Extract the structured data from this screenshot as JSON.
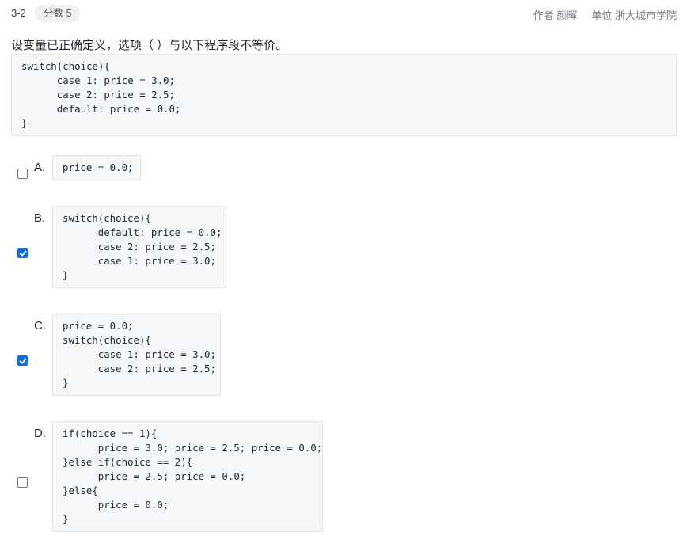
{
  "header": {
    "question_number": "3-2",
    "score": "分数 5",
    "author": "作者 颜晖",
    "unit": "单位 浙大城市学院"
  },
  "question": {
    "text": "设变量已正确定义，选项（ ）与以下程序段不等价。",
    "code": "switch(choice){\n      case 1: price = 3.0;\n      case 2: price = 2.5;\n      default: price = 0.0;\n}"
  },
  "options": [
    {
      "label": "A.",
      "checked": false,
      "code": "price = 0.0;"
    },
    {
      "label": "B.",
      "checked": true,
      "code": "switch(choice){\n      default: price = 0.0;\n      case 2: price = 2.5;\n      case 1: price = 3.0;\n}"
    },
    {
      "label": "C.",
      "checked": true,
      "code": "price = 0.0;\nswitch(choice){\n      case 1: price = 3.0;\n      case 2: price = 2.5;\n}"
    },
    {
      "label": "D.",
      "checked": false,
      "code": "if(choice == 1){\n      price = 3.0; price = 2.5; price = 0.0;\n}else if(choice == 2){\n      price = 2.5; price = 0.0;\n}else{\n      price = 0.0;\n}"
    }
  ],
  "colors": {
    "accent": "#0a6ee0",
    "code_bg": "#f6f7f9",
    "code_border": "#e3e5e8"
  }
}
